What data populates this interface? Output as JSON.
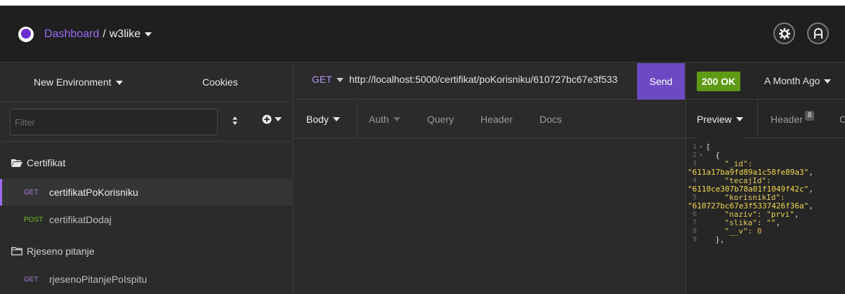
{
  "titlebar": {
    "dashboard_label": "Dashboard",
    "separator": "/",
    "project_name": "w3like",
    "settings_glyph": "✿",
    "account_glyph": "A"
  },
  "sidebar": {
    "environment_label": "New Environment",
    "cookies_label": "Cookies",
    "filter_placeholder": "Filter",
    "sort_glyph": "⇕",
    "add_glyph": "⊕",
    "tree": [
      {
        "type": "folder",
        "label": "Certifikat",
        "open": true
      },
      {
        "type": "request",
        "method": "GET",
        "label": "certifikatPoKorisniku",
        "active": true
      },
      {
        "type": "request",
        "method": "POST",
        "label": "certifikatDodaj"
      },
      {
        "type": "folder",
        "label": "Rjeseno pitanje",
        "open": false
      },
      {
        "type": "request",
        "method": "GET",
        "label": "rjesenoPitanjePoIspitu"
      }
    ]
  },
  "request": {
    "method": "GET",
    "url": "http://localhost:5000/certifikat/poKorisniku/610727bc67e3f533",
    "send_label": "Send",
    "tabs": [
      "Body",
      "Auth",
      "Query",
      "Header",
      "Docs"
    ]
  },
  "response": {
    "status": "200 OK",
    "time_label": "A Month Ago",
    "preview_tab": "Preview",
    "header_tab": "Header",
    "header_count": "8",
    "next_tab_partial": "C",
    "code_lines": [
      {
        "n": "1",
        "fold": "▾",
        "parts": [
          {
            "t": "[",
            "c": "punc"
          }
        ]
      },
      {
        "n": "2",
        "fold": "▾",
        "parts": [
          {
            "t": "  {",
            "c": "punc"
          }
        ]
      },
      {
        "n": "3",
        "fold": "",
        "parts": [
          {
            "t": "    \"_id\":",
            "c": "key"
          }
        ]
      },
      {
        "n": "",
        "fold": "",
        "parts": [
          {
            "t": "\"611a17ba9fd89a1c58fe89a3\"",
            "c": "str"
          },
          {
            "t": ",",
            "c": "punc"
          }
        ]
      },
      {
        "n": "4",
        "fold": "",
        "parts": [
          {
            "t": "    \"tecajId\":",
            "c": "key"
          }
        ]
      },
      {
        "n": "",
        "fold": "",
        "parts": [
          {
            "t": "\"6110ce307b78a01f1049f42c\"",
            "c": "str"
          },
          {
            "t": ",",
            "c": "punc"
          }
        ]
      },
      {
        "n": "5",
        "fold": "",
        "parts": [
          {
            "t": "    \"korisnikId\":",
            "c": "key"
          }
        ]
      },
      {
        "n": "",
        "fold": "",
        "parts": [
          {
            "t": "\"610727bc67e3f5337426f36a\"",
            "c": "str"
          },
          {
            "t": ",",
            "c": "punc"
          }
        ]
      },
      {
        "n": "6",
        "fold": "",
        "parts": [
          {
            "t": "    \"naziv\": ",
            "c": "key"
          },
          {
            "t": "\"prvi\"",
            "c": "str"
          },
          {
            "t": ",",
            "c": "punc"
          }
        ]
      },
      {
        "n": "7",
        "fold": "",
        "parts": [
          {
            "t": "    \"slika\": ",
            "c": "key"
          },
          {
            "t": "\"\"",
            "c": "str"
          },
          {
            "t": ",",
            "c": "punc"
          }
        ]
      },
      {
        "n": "8",
        "fold": "",
        "parts": [
          {
            "t": "    \"__v\": ",
            "c": "key"
          },
          {
            "t": "0",
            "c": "num"
          }
        ]
      },
      {
        "n": "9",
        "fold": "",
        "parts": [
          {
            "t": "  },",
            "c": "punc"
          }
        ]
      }
    ]
  },
  "colors": {
    "accent": "#9a6cf5",
    "send": "#6d4ac3",
    "status_ok": "#5e9a14",
    "method_get": "#a57fe0",
    "method_post": "#75ba24"
  }
}
